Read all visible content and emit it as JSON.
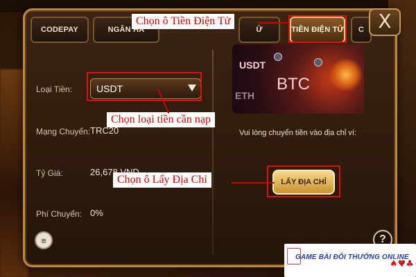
{
  "tabs": [
    {
      "label": "CODEPAY"
    },
    {
      "label": "NGÂN HÀ"
    },
    {
      "label": "Ử"
    },
    {
      "label": "TIỀN ĐIỆN TỬ"
    },
    {
      "label": "C"
    }
  ],
  "close_label": "X",
  "form": {
    "currency_label": "Loại Tiền:",
    "currency_value": "USDT",
    "network_label": "Mạng Chuyển:",
    "network_value": "TRC20",
    "rate_label": "Tỷ Giá:",
    "rate_value": "26,678 VND",
    "fee_label": "Phí Chuyển:",
    "fee_value": "0%"
  },
  "banner": {
    "usdt": "USDT",
    "btc": "BTC",
    "eth": "ETH"
  },
  "deposit_info": "Vui lòng chuyển tiền vào địa chỉ ví:",
  "get_address_label": "LẤY ĐỊA CHỈ",
  "help_label": "?",
  "doc_icon_glyph": "≡",
  "annotations": {
    "tab_callout": "Chọn ô Tiền Điện Tử",
    "currency_callout": "Chọn loại tiền cần nạp",
    "address_callout": "Chọn ô Lấy Địa Chỉ"
  },
  "watermark": {
    "text": "GAME BÀI ĐỔI THƯỞNG ONLINE",
    "suits": "♠♥♣♦"
  },
  "colors": {
    "annotation_red": "#e01010",
    "active_tab_border": "#f0c779",
    "button_gold": "#c9932e"
  }
}
